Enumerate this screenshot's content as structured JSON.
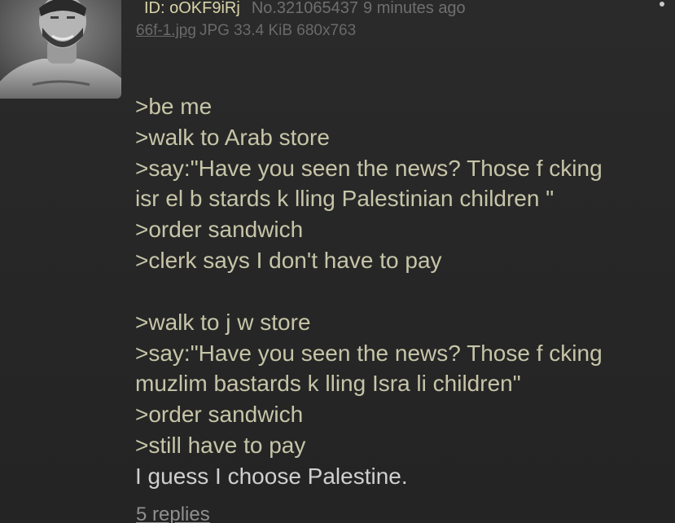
{
  "post": {
    "poster_id": "ID: oOKF9iRj",
    "number": "No.321065437",
    "time_ago": "9 minutes ago",
    "file": {
      "name": "66f-1.jpg",
      "meta": "JPG 33.4 KiB 680x763"
    },
    "thumbnail_alt": "thumbnail-image",
    "body_lines": [
      {
        "kind": "greentext",
        "text": ">be me"
      },
      {
        "kind": "greentext",
        "text": ">walk to Arab store"
      },
      {
        "kind": "greentext",
        "text": ">say:\"Have you seen the news? Those f  cking"
      },
      {
        "kind": "greentext",
        "text": "isr  el b  stards k  lling Palestinian children \""
      },
      {
        "kind": "greentext",
        "text": ">order sandwich"
      },
      {
        "kind": "greentext",
        "text": ">clerk says I don't have to pay"
      },
      {
        "kind": "blank",
        "text": ""
      },
      {
        "kind": "greentext",
        "text": ">walk to j  w store"
      },
      {
        "kind": "greentext",
        "text": ">say:\"Have you seen the news? Those f  cking"
      },
      {
        "kind": "greentext",
        "text": "muzlim bastards k  lling Isra  li children\""
      },
      {
        "kind": "greentext",
        "text": ">order sandwich"
      },
      {
        "kind": "greentext",
        "text": ">still have to pay"
      },
      {
        "kind": "plain",
        "text": "I guess I choose Palestine."
      }
    ],
    "replies": "5 replies"
  },
  "icons": {
    "menu": "vertical-dots-menu-icon"
  },
  "colors": {
    "background": "#262626",
    "greentext": "#c6c5a8",
    "plain_text": "#cfcfcf",
    "poster_id": "#d9d4a8",
    "muted": "#6f6f6f"
  }
}
